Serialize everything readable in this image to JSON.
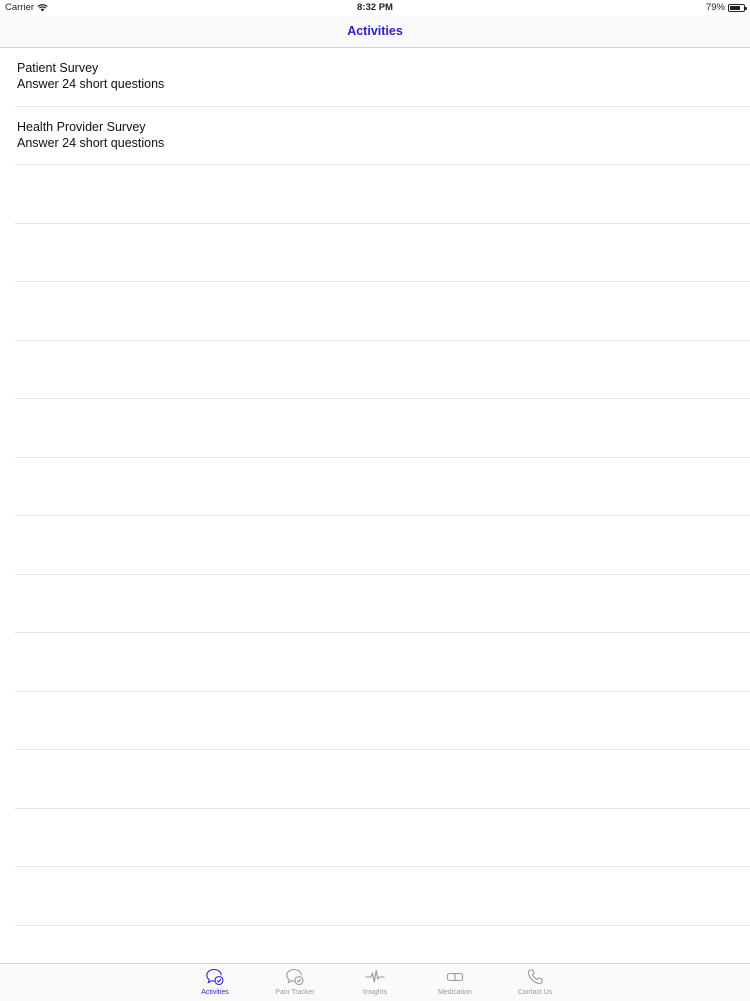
{
  "status_bar": {
    "carrier": "Carrier",
    "time": "8:32 PM",
    "battery_text": "79%",
    "battery_level": 0.79
  },
  "nav": {
    "title": "Activities"
  },
  "activities": [
    {
      "title": "Patient Survey",
      "subtitle": "Answer 24 short questions"
    },
    {
      "title": "Health Provider Survey",
      "subtitle": "Answer 24 short questions"
    },
    {
      "title": "",
      "subtitle": ""
    },
    {
      "title": "",
      "subtitle": ""
    },
    {
      "title": "",
      "subtitle": ""
    },
    {
      "title": "",
      "subtitle": ""
    },
    {
      "title": "",
      "subtitle": ""
    },
    {
      "title": "",
      "subtitle": ""
    },
    {
      "title": "",
      "subtitle": ""
    },
    {
      "title": "",
      "subtitle": ""
    },
    {
      "title": "",
      "subtitle": ""
    },
    {
      "title": "",
      "subtitle": ""
    },
    {
      "title": "",
      "subtitle": ""
    },
    {
      "title": "",
      "subtitle": ""
    },
    {
      "title": "",
      "subtitle": ""
    },
    {
      "title": "",
      "subtitle": ""
    }
  ],
  "tabs": [
    {
      "label": "Activities",
      "icon": "chat-check-icon",
      "active": true
    },
    {
      "label": "Pain Tracker",
      "icon": "chat-check-icon",
      "active": false
    },
    {
      "label": "Insights",
      "icon": "pulse-icon",
      "active": false
    },
    {
      "label": "Medication",
      "icon": "pill-icon",
      "active": false
    },
    {
      "label": "Contact Us",
      "icon": "phone-icon",
      "active": false
    }
  ],
  "colors": {
    "accent": "#2b1fd0",
    "inactive": "#9a9aa0"
  }
}
